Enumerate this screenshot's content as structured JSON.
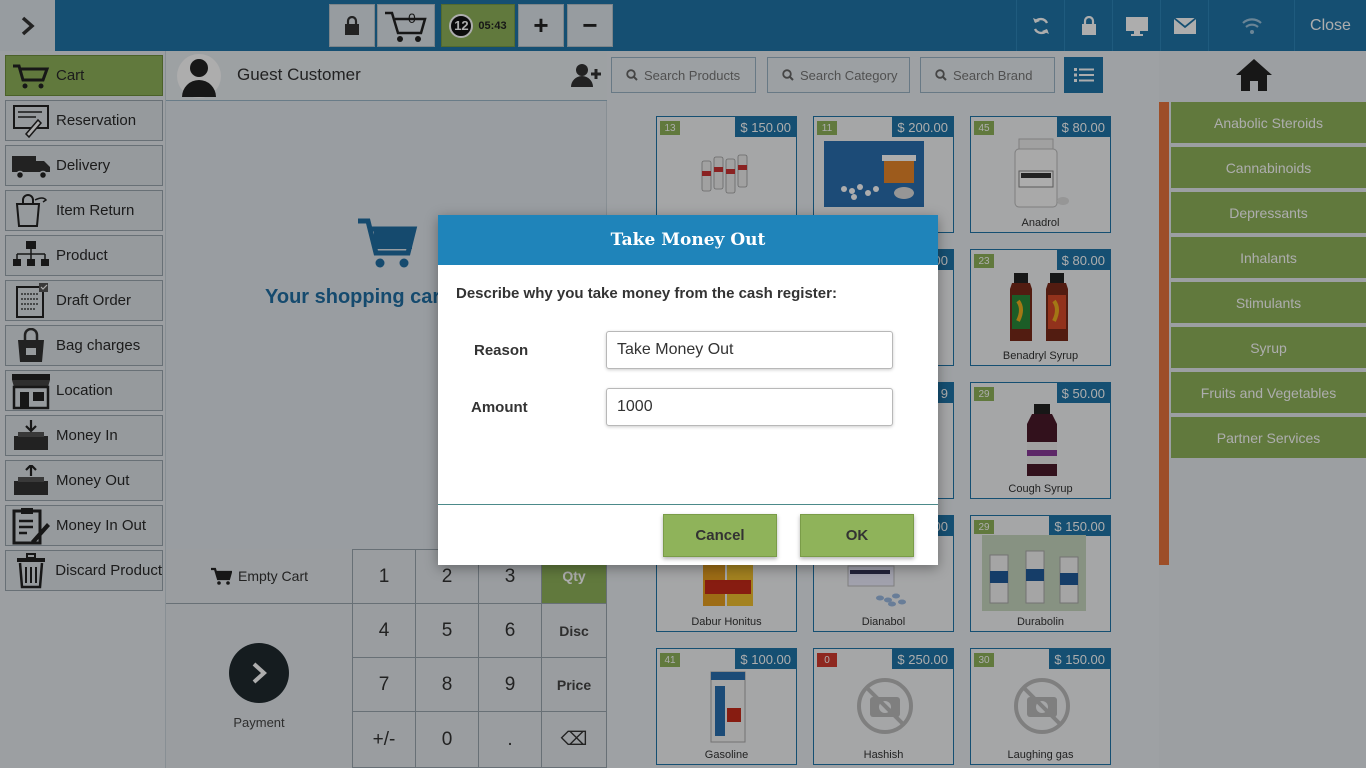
{
  "topbar": {
    "cart_count": "0",
    "badge_number": "12",
    "timer": "05:43",
    "plus": "+",
    "minus": "−",
    "close_label": "Close"
  },
  "nav": {
    "items": [
      {
        "label": "Cart",
        "icon": "cart-icon",
        "active": true
      },
      {
        "label": "Reservation",
        "icon": "reservation-icon"
      },
      {
        "label": "Delivery",
        "icon": "delivery-truck-icon"
      },
      {
        "label": "Item Return",
        "icon": "item-return-icon"
      },
      {
        "label": "Product",
        "icon": "product-tree-icon"
      },
      {
        "label": "Draft Order",
        "icon": "draft-order-icon"
      },
      {
        "label": "Bag charges",
        "icon": "bag-icon"
      },
      {
        "label": "Location",
        "icon": "store-icon"
      },
      {
        "label": "Money In",
        "icon": "money-in-icon"
      },
      {
        "label": "Money Out",
        "icon": "money-out-icon"
      },
      {
        "label": "Money In Out",
        "icon": "clipboard-edit-icon"
      },
      {
        "label": "Discard Product",
        "icon": "trash-icon"
      }
    ]
  },
  "cart": {
    "customer_name": "Guest Customer",
    "empty_message": "Your shopping cart i",
    "empty_cart_label": "Empty Cart",
    "payment_label": "Payment"
  },
  "keypad": {
    "keys": [
      "1",
      "2",
      "3",
      "Qty",
      "4",
      "5",
      "6",
      "Disc",
      "7",
      "8",
      "9",
      "Price",
      "+/-",
      "0",
      ".",
      "⌫"
    ]
  },
  "search": {
    "products": "Search Products",
    "category": "Search Category",
    "brand": "Search Brand"
  },
  "products": [
    {
      "stock": "13",
      "price": "$ 150.00",
      "name": ""
    },
    {
      "stock": "11",
      "price": "$ 200.00",
      "name": ""
    },
    {
      "stock": "45",
      "price": "$ 80.00",
      "name": "Anadrol"
    },
    {
      "stock": "",
      "price": "00",
      "name": ""
    },
    {
      "stock": "",
      "price": "00",
      "name": ""
    },
    {
      "stock": "23",
      "price": "$ 80.00",
      "name": "Benadryl Syrup"
    },
    {
      "stock": "",
      "price": "",
      "name": ""
    },
    {
      "stock": "",
      "price": "9",
      "name": ""
    },
    {
      "stock": "29",
      "price": "$ 50.00",
      "name": "Cough Syrup"
    },
    {
      "stock": "",
      "price": "",
      "name": "Dabur Honitus"
    },
    {
      "stock": "",
      "price": "00",
      "name": "Dianabol"
    },
    {
      "stock": "29",
      "price": "$ 150.00",
      "name": "Durabolin"
    },
    {
      "stock": "41",
      "price": "$ 100.00",
      "name": "Gasoline"
    },
    {
      "stock": "0",
      "price": "$ 250.00",
      "name": "Hashish"
    },
    {
      "stock": "30",
      "price": "$ 150.00",
      "name": "Laughing gas"
    }
  ],
  "categories": [
    "Anabolic Steroids",
    "Cannabinoids",
    "Depressants",
    "Inhalants",
    "Stimulants",
    "Syrup",
    "Fruits and Vegetables",
    "Partner Services"
  ],
  "modal": {
    "title": "Take Money Out",
    "description": "Describe why you take money from the cash register:",
    "reason_label": "Reason",
    "reason_value": "Take Money Out",
    "amount_label": "Amount",
    "amount_value": "1000",
    "cancel_label": "Cancel",
    "ok_label": "OK"
  },
  "colors": {
    "brand_blue": "#1f75a8",
    "accent_green": "#8fb35a",
    "accent_orange": "#e8743b"
  }
}
